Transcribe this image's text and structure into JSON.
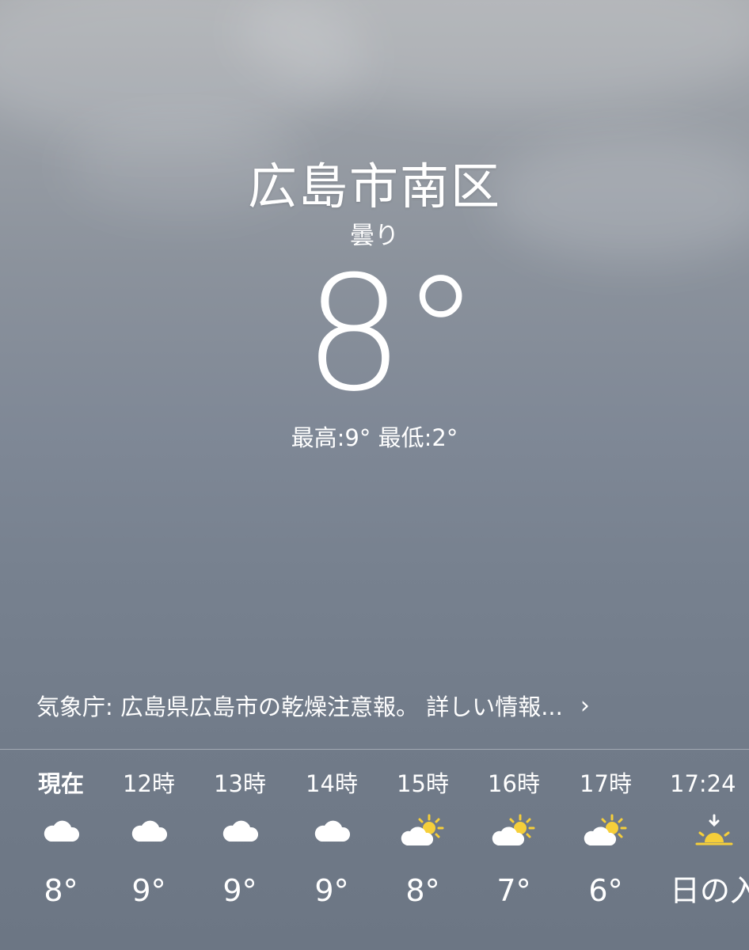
{
  "location": {
    "city": "広島市南区",
    "condition": "曇り",
    "temperature": "8°",
    "hilo": "最高:9° 最低:2°"
  },
  "alert": {
    "text": "気象庁: 広島県広島市の乾燥注意報。 詳しい情報...",
    "chevron": "›"
  },
  "hourly": [
    {
      "time": "現在",
      "icon": "cloud-icon",
      "temp": "8°"
    },
    {
      "time": "12時",
      "icon": "cloud-icon",
      "temp": "9°"
    },
    {
      "time": "13時",
      "icon": "cloud-icon",
      "temp": "9°"
    },
    {
      "time": "14時",
      "icon": "cloud-icon",
      "temp": "9°"
    },
    {
      "time": "15時",
      "icon": "partly-sunny-icon",
      "temp": "8°"
    },
    {
      "time": "16時",
      "icon": "partly-sunny-icon",
      "temp": "7°"
    },
    {
      "time": "17時",
      "icon": "partly-sunny-icon",
      "temp": "6°"
    },
    {
      "time": "17:24",
      "icon": "sunset-icon",
      "temp": "日の入"
    }
  ],
  "colors": {
    "sun": "#f6cf3a",
    "cloud": "#ffffff"
  }
}
